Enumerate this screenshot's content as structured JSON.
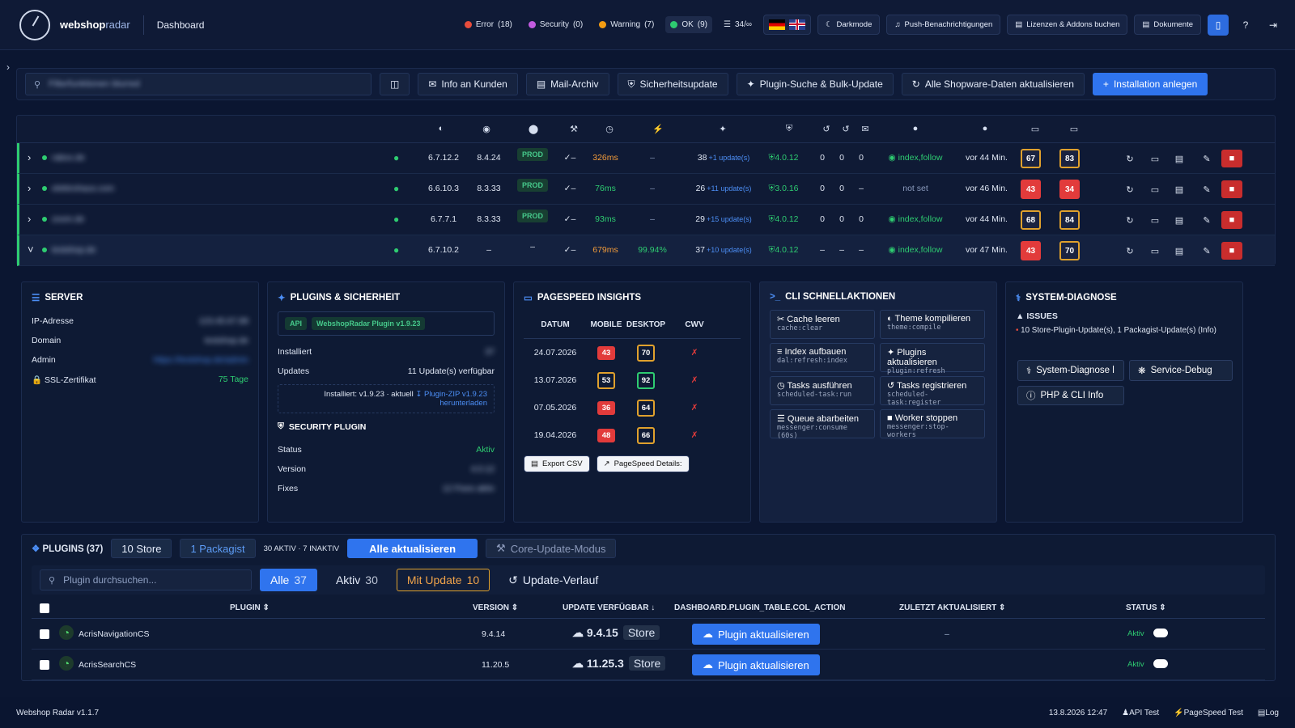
{
  "app": {
    "brand_a": "webshop",
    "brand_b": "radar",
    "page": "Dashboard",
    "version": "Webshop Radar v1.1.7"
  },
  "status": {
    "error": "Error",
    "error_count": "(18)",
    "security": "Security",
    "security_count": "(0)",
    "warning": "Warning",
    "warning_count": "(7)",
    "ok": "OK",
    "ok_count": "(9)",
    "quota": "34/∞"
  },
  "topbuttons": {
    "darkmode": "Darkmode",
    "push": "Push-Benachrichtigungen",
    "licenses": "Lizenzen & Addons buchen",
    "docs": "Dokumente"
  },
  "toolbar": {
    "search_placeholder": "Filterfunktionen blurred",
    "info": "Info an Kunden",
    "mail": "Mail-Archiv",
    "secupdate": "Sicherheitsupdate",
    "bulk": "Plugin-Suche & Bulk-Update",
    "refresh": "Alle Shopware-Daten aktualisieren",
    "create": "Installation anlegen"
  },
  "rows": [
    {
      "domain": "rabox.de",
      "sw": "6.7.12.2",
      "php": "8.4.24",
      "env": "PROD",
      "resp": "326ms",
      "uptime": "–",
      "plugins": "38",
      "upd": "+1 update(s)",
      "sec": "4.0.12",
      "a": "0",
      "b": "0",
      "c": "0",
      "robots": "index,follow",
      "last": "vor 44 Min.",
      "m": "67",
      "d": "83"
    },
    {
      "domain": "elektrohaus.com",
      "sw": "6.6.10.3",
      "php": "8.3.33",
      "env": "PROD",
      "resp": "76ms",
      "uptime": "–",
      "plugins": "26",
      "upd": "+11 update(s)",
      "sec": "3.0.16",
      "a": "0",
      "b": "0",
      "c": "–",
      "robots": "not set",
      "last": "vor 46 Min.",
      "m": "43",
      "d": "34"
    },
    {
      "domain": "zoom.de",
      "sw": "6.7.7.1",
      "php": "8.3.33",
      "env": "PROD",
      "resp": "93ms",
      "uptime": "–",
      "plugins": "29",
      "upd": "+15 update(s)",
      "sec": "4.0.12",
      "a": "0",
      "b": "0",
      "c": "0",
      "robots": "index,follow",
      "last": "vor 44 Min.",
      "m": "68",
      "d": "84"
    },
    {
      "domain": "testshop.de",
      "sw": "6.7.10.2",
      "php": "–",
      "env": "–",
      "resp": "679ms",
      "uptime": "99.94%",
      "plugins": "37",
      "upd": "+10 update(s)",
      "sec": "4.0.12",
      "a": "–",
      "b": "–",
      "c": "–",
      "robots": "index,follow",
      "last": "vor 47 Min.",
      "m": "43",
      "d": "70"
    }
  ],
  "server": {
    "title": "SERVER",
    "ip_label": "IP-Adresse",
    "ip": "123.45.67.89",
    "domain_label": "Domain",
    "domain": "testshop.de",
    "admin_label": "Admin",
    "admin": "https://testshop.de/admin",
    "ssl_label": "SSL-Zertifikat",
    "ssl": "75 Tage"
  },
  "pluginsec": {
    "title": "PLUGINS & SICHERHEIT",
    "api": "API",
    "wr": "WebshopRadar Plugin v1.9.23",
    "installed_label": "Installiert",
    "installed": "37",
    "updates_label": "Updates",
    "updates": "11 Update(s) verfügbar",
    "inst_ver": "Installiert: v1.9.23 · aktuell",
    "zip": "Plugin-ZIP v1.9.23",
    "download": "herunterladen",
    "secplugin": "SECURITY PLUGIN",
    "status_label": "Status",
    "status": "Aktiv",
    "version_label": "Version",
    "version": "4.0.12",
    "fixes_label": "Fixes",
    "fixes": "12 Fixes aktiv"
  },
  "pagespeed": {
    "title": "PAGESPEED INSIGHTS",
    "h_date": "DATUM",
    "h_mobile": "MOBILE",
    "h_desktop": "DESKTOP",
    "h_cwv": "CWV",
    "rows": [
      {
        "date": "24.07.2026",
        "m": "43",
        "d": "70"
      },
      {
        "date": "13.07.2026",
        "m": "53",
        "d": "92"
      },
      {
        "date": "07.05.2026",
        "m": "36",
        "d": "64"
      },
      {
        "date": "19.04.2026",
        "m": "48",
        "d": "66"
      }
    ],
    "export": "Export CSV",
    "details": "PageSpeed Details:"
  },
  "cli": {
    "title": "CLI SCHNELLAKTIONEN",
    "items": [
      {
        "t": "Cache leeren",
        "c": "cache:clear"
      },
      {
        "t": "Theme kompilieren",
        "c": "theme:compile"
      },
      {
        "t": "Index aufbauen",
        "c": "dal:refresh:index"
      },
      {
        "t": "Plugins aktualisieren",
        "c": "plugin:refresh"
      },
      {
        "t": "Tasks ausführen",
        "c": "scheduled-task:run"
      },
      {
        "t": "Tasks registrieren",
        "c": "scheduled-task:register"
      },
      {
        "t": "Queue abarbeiten",
        "c": "messenger:consume (60s)"
      },
      {
        "t": "Worker stoppen",
        "c": "messenger:stop-workers"
      }
    ]
  },
  "diag": {
    "title": "SYSTEM-DIAGNOSE",
    "issues": "ISSUES",
    "issue1": "10 Store-Plugin-Update(s), 1 Packagist-Update(s) (Info)",
    "b1": "System-Diagnose l",
    "b2": "Service-Debug",
    "b3": "PHP & CLI Info"
  },
  "pluginlist": {
    "title": "PLUGINS (37)",
    "store": "10 Store",
    "packagist": "1 Packagist",
    "active": "30 AKTIV · 7 INAKTIV",
    "update_all": "Alle aktualisieren",
    "core": "Core-Update-Modus",
    "search": "Plugin durchsuchen...",
    "f_all": "Alle",
    "f_all_n": "37",
    "f_active": "Aktiv",
    "f_active_n": "30",
    "f_upd": "Mit Update",
    "f_upd_n": "10",
    "history": "Update-Verlauf",
    "h_plugin": "PLUGIN",
    "h_version": "VERSION",
    "h_update": "UPDATE VERFÜGBAR",
    "h_action": "DASHBOARD.PLUGIN_TABLE.COL_ACTION",
    "h_last": "ZULETZT AKTUALISIERT",
    "h_status": "STATUS",
    "rows": [
      {
        "name": "AcrisNavigationCS",
        "ver": "9.4.14",
        "upd": "9.4.15",
        "src": "Store",
        "btn": "Plugin aktualisieren",
        "last": "–",
        "status": "Aktiv"
      },
      {
        "name": "AcrisSearchCS",
        "ver": "11.20.5",
        "upd": "11.25.3",
        "src": "Store",
        "btn": "Plugin aktualisieren",
        "last": "",
        "status": "Aktiv"
      }
    ]
  },
  "footer": {
    "time": "13.8.2026 12:47",
    "api": "API Test",
    "ps": "PageSpeed Test",
    "log": "Log"
  }
}
